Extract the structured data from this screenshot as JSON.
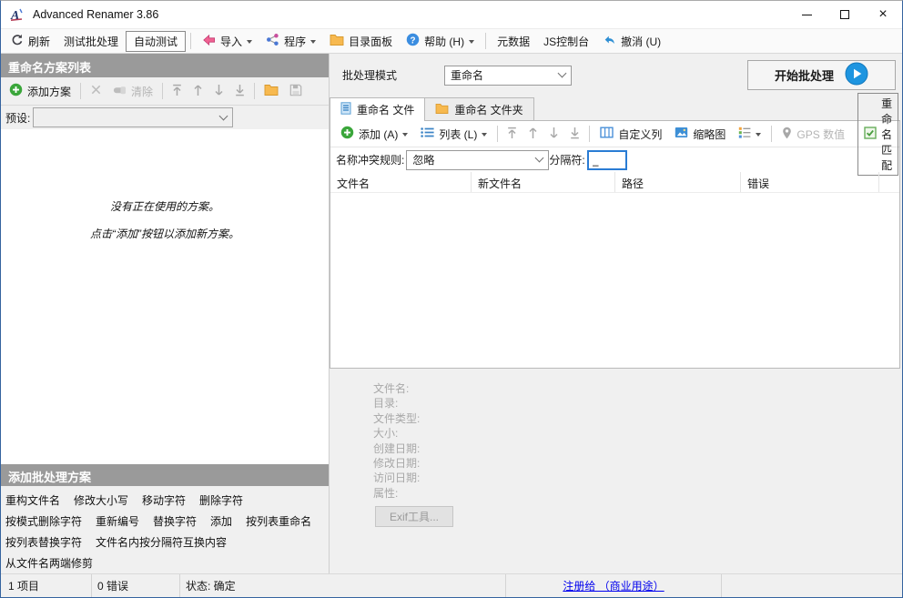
{
  "window": {
    "title": "Advanced Renamer 3.86"
  },
  "toolbar": {
    "refresh": "刷新",
    "test_batch": "测试批处理",
    "auto_test": "自动测试",
    "import": "导入",
    "program": "程序",
    "dir_panel": "目录面板",
    "help": "帮助 (H)",
    "metadata": "元数据",
    "js_console": "JS控制台",
    "undo": "撤消 (U)"
  },
  "left_panel": {
    "header": "重命名方案列表",
    "add_method": "添加方案",
    "clear": "清除",
    "preset_label": "预设:",
    "preset_value": "",
    "empty_line1": "没有正在使用的方案。",
    "empty_line2": "点击“添加”按钮以添加新方案。",
    "add_methods_header": "添加批处理方案",
    "method_rows": [
      [
        "重构文件名",
        "修改大小写",
        "移动字符",
        "删除字符"
      ],
      [
        "按模式删除字符",
        "重新编号",
        "替换字符",
        "添加",
        "按列表重命名"
      ],
      [
        "按列表替换字符",
        "文件名内按分隔符互换内容"
      ],
      [
        "从文件名两端修剪"
      ]
    ]
  },
  "batch": {
    "mode_label": "批处理模式",
    "mode_value": "重命名",
    "start_button": "开始批处理"
  },
  "tabs": [
    {
      "label": "重命名 文件"
    },
    {
      "label": "重命名 文件夹"
    }
  ],
  "file_toolbar": {
    "add": "添加 (A)",
    "list": "列表 (L)",
    "custom_columns": "自定义列",
    "thumbnails": "缩略图",
    "gps": "GPS 数值",
    "rename_match": "重命名匹配"
  },
  "filter": {
    "collision_label": "名称冲突规则:",
    "collision_value": "忽略",
    "separator_label": "分隔符:",
    "separator_value": "_"
  },
  "table": {
    "columns": [
      "文件名",
      "新文件名",
      "路径",
      "错误"
    ]
  },
  "file_info": {
    "labels": [
      "文件名:",
      "目录:",
      "文件类型:",
      "大小:",
      "创建日期:",
      "修改日期:",
      "访问日期:",
      "属性:"
    ],
    "exif_button": "Exif工具..."
  },
  "status_bar": {
    "items": "1 项目",
    "errors": "0 错误",
    "status": "状态: 确定",
    "registered": "注册给 （商业用途）"
  },
  "colors": {
    "accent_blue": "#1e95e0",
    "add_green": "#3aa63a",
    "folder_orange": "#f5b84c",
    "link_blue": "#0000ee",
    "header_gray": "#9a9a9a",
    "focus_blue": "#2a7cd4"
  }
}
